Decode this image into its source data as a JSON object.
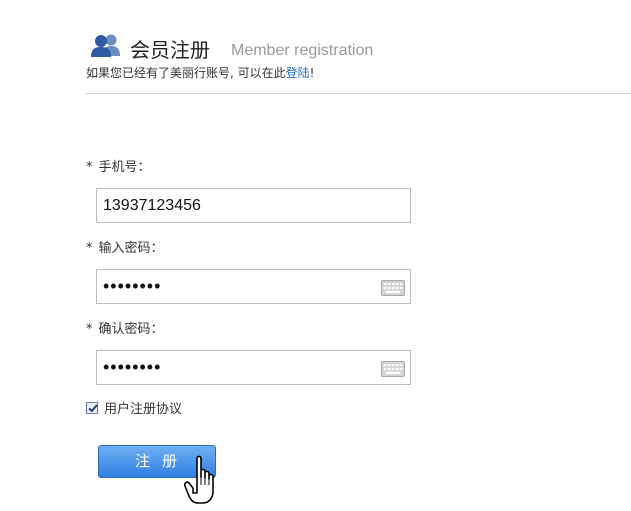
{
  "header": {
    "title_cn": "会员注册",
    "title_en": "Member registration",
    "subtitle_prefix": "如果您已经有了美丽行账号, 可以在此",
    "login_link": "登陆",
    "subtitle_suffix": "!"
  },
  "form": {
    "phone": {
      "star": "*",
      "label": "手机号：",
      "value": "13937123456"
    },
    "password": {
      "star": "*",
      "label": "输入密码：",
      "value": "••••••••"
    },
    "confirm": {
      "star": "*",
      "label": "确认密码：",
      "value": "••••••••"
    },
    "agreement": {
      "label": "用户注册协议",
      "checked": true
    },
    "submit_label": "注册"
  },
  "colors": {
    "link": "#1a6fc4",
    "button": "#3a8ae6",
    "divider": "#cfcfcf"
  },
  "icons": {
    "header": "users-icon",
    "keyboard": "keyboard-icon",
    "cursor": "hand-cursor-icon"
  }
}
